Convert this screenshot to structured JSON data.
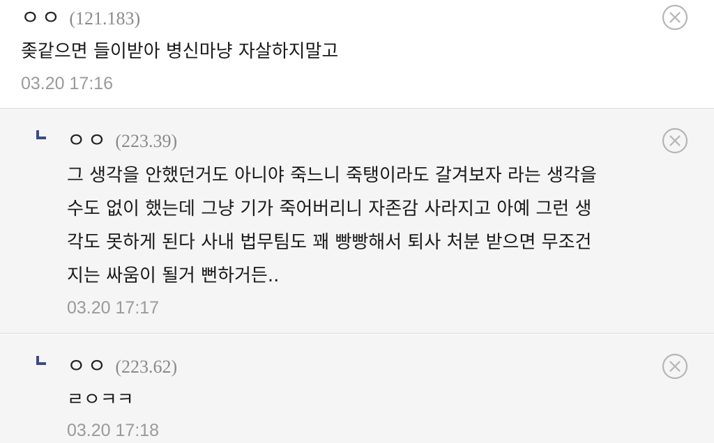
{
  "comments": [
    {
      "author": "ㅇㅇ",
      "ip": "(121.183)",
      "text_lines": [
        "좆같으면 들이받아 병신마냥 자살하지말고"
      ],
      "timestamp": "03.20 17:16",
      "is_reply": false
    },
    {
      "author": "ㅇㅇ",
      "ip": "(223.39)",
      "text_lines": [
        "그 생각을 안했던거도 아니야 죽느니 죽탱이라도 갈겨보자 라는 생각을",
        "수도 없이 했는데 그냥 기가 죽어버리니 자존감 사라지고 아예 그런 생",
        "각도 못하게 된다 사내 법무팀도 꽤 빵빵해서 퇴사 처분 받으면 무조건",
        "지는 싸움이 될거 뻔하거든.."
      ],
      "timestamp": "03.20 17:17",
      "is_reply": true
    },
    {
      "author": "ㅇㅇ",
      "ip": "(223.62)",
      "text_lines": [
        "ㄹㅇㅋㅋ"
      ],
      "timestamp": "03.20 17:18",
      "is_reply": true
    }
  ],
  "icons": {
    "delete": "close-circle-icon",
    "reply_marker": "reply-arrow-icon"
  },
  "colors": {
    "reply_background": "#f5f5f5",
    "reply_marker": "#3c4a8a",
    "meta_text": "#9a9a9a",
    "divider": "#dcdcdc"
  }
}
